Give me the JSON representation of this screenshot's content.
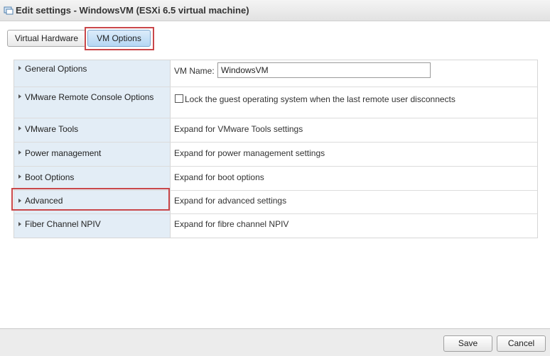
{
  "window": {
    "title": "Edit settings - WindowsVM (ESXi 6.5 virtual machine)",
    "icon": "vm-settings-icon"
  },
  "tabs": [
    {
      "label": "Virtual Hardware",
      "active": false
    },
    {
      "label": "VM Options",
      "active": true,
      "highlighted": true
    }
  ],
  "rows": [
    {
      "label": "General Options",
      "field_label": "VM Name:",
      "field_value": "WindowsVM"
    },
    {
      "label": "VMware Remote Console Options",
      "checkbox_label": "Lock the guest operating system when the last remote user disconnects",
      "checked": false
    },
    {
      "label": "VMware Tools",
      "value": "Expand for VMware Tools settings"
    },
    {
      "label": "Power management",
      "value": "Expand for power management settings"
    },
    {
      "label": "Boot Options",
      "value": "Expand for boot options"
    },
    {
      "label": "Advanced",
      "value": "Expand for advanced settings",
      "highlighted": true
    },
    {
      "label": "Fiber Channel NPIV",
      "value": "Expand for fibre channel NPIV"
    }
  ],
  "footer": {
    "save_label": "Save",
    "cancel_label": "Cancel"
  },
  "colors": {
    "highlight": "#c9474a",
    "label_column_bg": "#e3edf6",
    "active_tab_bg": "#b6d7f4"
  }
}
